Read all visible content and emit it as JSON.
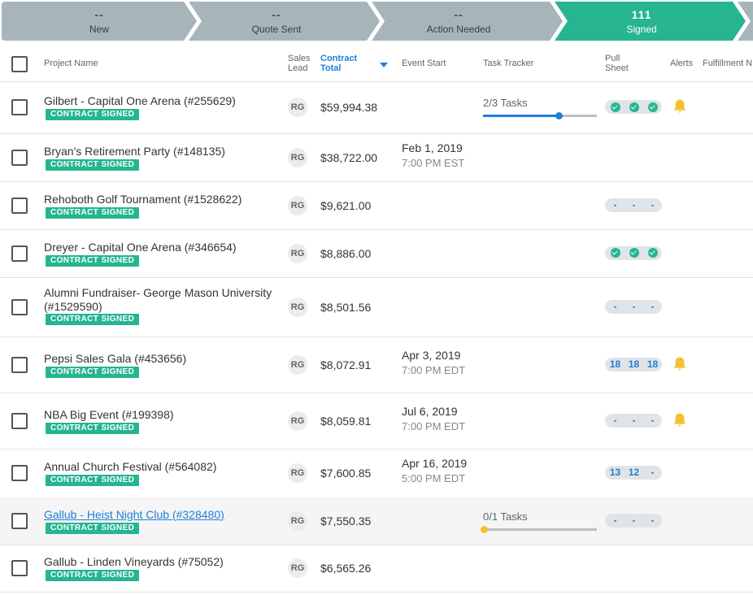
{
  "pipeline": [
    {
      "count": "--",
      "label": "New",
      "active": false
    },
    {
      "count": "--",
      "label": "Quote Sent",
      "active": false
    },
    {
      "count": "--",
      "label": "Action Needed",
      "active": false
    },
    {
      "count": "111",
      "label": "Signed",
      "active": true
    }
  ],
  "colors": {
    "stage": "#a7b5ba",
    "active_stage": "#26b590",
    "badge": "#26b590",
    "link": "#1e7fd6",
    "bell": "#f5c130"
  },
  "columns": {
    "project_name": "Project Name",
    "sales_lead": "Sales Lead",
    "contract_total": "Contract Total",
    "event_start": "Event Start",
    "task_tracker": "Task Tracker",
    "pull_sheet": "Pull Sheet",
    "alerts": "Alerts",
    "fulfillment": "Fulfillment N"
  },
  "rows": [
    {
      "name": "Gilbert - Capital One Arena (#255629)",
      "status": "CONTRACT SIGNED",
      "lead": "RG",
      "total": "$59,994.38",
      "date": "",
      "time": "",
      "tasks": "2/3 Tasks",
      "task_progress": 0.67,
      "pull": [
        "check",
        "check",
        "check"
      ],
      "alert": true
    },
    {
      "name": "Bryan's Retirement Party (#148135)",
      "status": "CONTRACT SIGNED",
      "lead": "RG",
      "total": "$38,722.00",
      "date": "Feb 1, 2019",
      "time": "7:00 PM EST",
      "tasks": "",
      "pull": [],
      "alert": false
    },
    {
      "name": "Rehoboth Golf Tournament (#1528622)",
      "status": "CONTRACT SIGNED",
      "lead": "RG",
      "total": "$9,621.00",
      "date": "",
      "time": "",
      "tasks": "",
      "pull": [
        "-",
        "-",
        "-"
      ],
      "alert": false
    },
    {
      "name": "Dreyer - Capital One Arena (#346654)",
      "status": "CONTRACT SIGNED",
      "lead": "RG",
      "total": "$8,886.00",
      "date": "",
      "time": "",
      "tasks": "",
      "pull": [
        "check",
        "check",
        "check"
      ],
      "alert": false
    },
    {
      "name": "Alumni Fundraiser- George Mason University (#1529590)",
      "status": "CONTRACT SIGNED",
      "lead": "RG",
      "total": "$8,501.56",
      "date": "",
      "time": "",
      "tasks": "",
      "pull": [
        "-",
        "-",
        "-"
      ],
      "alert": false
    },
    {
      "name": "Pepsi Sales Gala (#453656)",
      "status": "CONTRACT SIGNED",
      "lead": "RG",
      "total": "$8,072.91",
      "date": "Apr 3, 2019",
      "time": "7:00 PM EDT",
      "tasks": "",
      "pull": [
        "18",
        "18",
        "18"
      ],
      "alert": true
    },
    {
      "name": "NBA Big Event (#199398)",
      "status": "CONTRACT SIGNED",
      "lead": "RG",
      "total": "$8,059.81",
      "date": "Jul 6, 2019",
      "time": "7:00 PM EDT",
      "tasks": "",
      "pull": [
        "-",
        "-",
        "-"
      ],
      "alert": true
    },
    {
      "name": "Annual Church Festival (#564082)",
      "status": "CONTRACT SIGNED",
      "lead": "RG",
      "total": "$7,600.85",
      "date": "Apr 16, 2019",
      "time": "5:00 PM EDT",
      "tasks": "",
      "pull": [
        "13",
        "12",
        "-"
      ],
      "alert": false
    },
    {
      "name": "Gallub - Heist Night Club (#328480)",
      "status": "CONTRACT SIGNED",
      "lead": "RG",
      "total": "$7,550.35",
      "date": "",
      "time": "",
      "tasks": "0/1 Tasks",
      "task_progress": 0,
      "pull": [
        "-",
        "-",
        "-"
      ],
      "alert": false,
      "link": true
    },
    {
      "name": "Gallub - Linden Vineyards (#75052)",
      "status": "CONTRACT SIGNED",
      "lead": "RG",
      "total": "$6,565.26",
      "date": "",
      "time": "",
      "tasks": "",
      "pull": [],
      "alert": false
    }
  ]
}
